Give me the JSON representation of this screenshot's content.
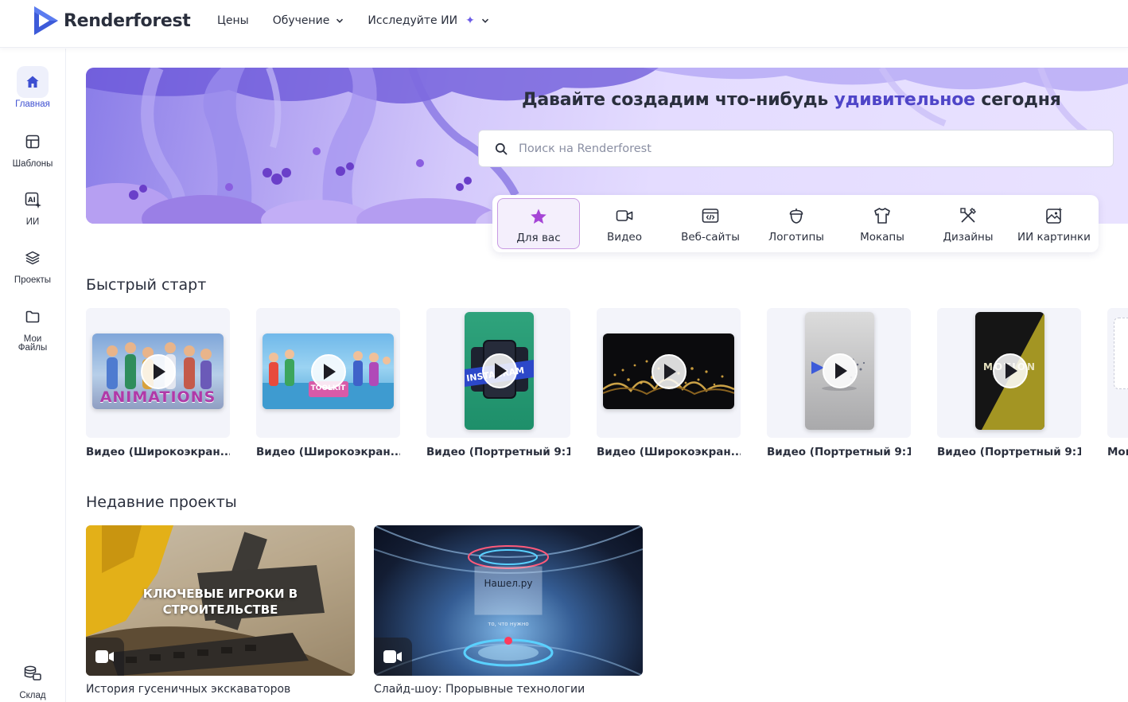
{
  "app": {
    "brand": "Renderforest"
  },
  "nav": [
    {
      "label": "Цены",
      "dropdown": false
    },
    {
      "label": "Обучение",
      "dropdown": true
    },
    {
      "label": "Исследуйте ИИ",
      "dropdown": true
    }
  ],
  "sidebar": {
    "items": [
      {
        "label": "Главная",
        "icon": "home-icon",
        "active": true
      },
      {
        "label": "Шаблоны",
        "icon": "templates-icon",
        "active": false
      },
      {
        "label": "ИИ",
        "icon": "ai-icon",
        "active": false
      },
      {
        "label": "Проекты",
        "icon": "layers-icon",
        "active": false
      },
      {
        "label": "Мои Файлы",
        "icon": "folder-icon",
        "active": false
      },
      {
        "label": "Склад",
        "icon": "storage-icon",
        "active": false
      }
    ]
  },
  "hero": {
    "title_before": "Давайте создадим что-нибудь",
    "title_highlight": "удивительное",
    "title_after": "сегодня",
    "search_placeholder": "Поиск на Renderforest"
  },
  "categories": [
    {
      "label": "Для вас",
      "icon": "star-icon",
      "active": true
    },
    {
      "label": "Видео",
      "icon": "video-camera-icon",
      "active": false
    },
    {
      "label": "Веб-сайты",
      "icon": "website-icon",
      "active": false
    },
    {
      "label": "Логотипы",
      "icon": "acorn-logo-icon",
      "active": false
    },
    {
      "label": "Мокапы",
      "icon": "tshirt-icon",
      "active": false
    },
    {
      "label": "Дизайны",
      "icon": "design-tools-icon",
      "active": false
    },
    {
      "label": "ИИ картинки",
      "icon": "ai-image-icon",
      "active": false
    }
  ],
  "quick_start": {
    "title": "Быстрый старт",
    "items": [
      {
        "caption": "Видео (Широкоэкран...",
        "thumb_text": "ANIMATIONS"
      },
      {
        "caption": "Видео (Широкоэкран...",
        "thumb_text": "TOOLKIT"
      },
      {
        "caption": "Видео (Портретный 9:1...",
        "thumb_text": "INSTAGRAM"
      },
      {
        "caption": "Видео (Широкоэкран...",
        "thumb_text": ""
      },
      {
        "caption": "Видео (Портретный 9:1...",
        "thumb_text": ""
      },
      {
        "caption": "Видео (Портретный 9:1...",
        "thumb_text": "MOTION"
      },
      {
        "caption": "Мок",
        "thumb_text": ""
      }
    ]
  },
  "recent": {
    "title": "Недавние проекты",
    "items": [
      {
        "caption": "История гусеничных экскаваторов",
        "thumb_text": "КЛЮЧЕВЫЕ ИГРОКИ В СТРОИТЕЛЬСТВЕ"
      },
      {
        "caption": "Слайд-шоу: Прорывные технологии",
        "thumb_text": "Нашел.ру",
        "thumb_subtext": "то, что нужно"
      }
    ]
  }
}
